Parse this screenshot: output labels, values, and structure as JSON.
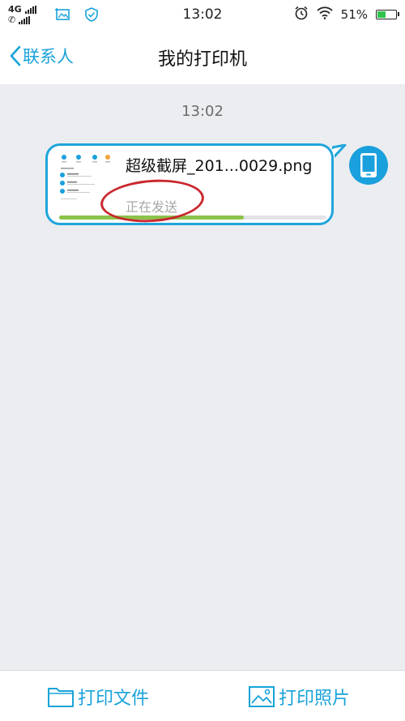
{
  "status_bar": {
    "network": "4G",
    "time": "13:02",
    "battery": "51%",
    "battery_level": 0.51,
    "icons": [
      "signal-icon",
      "call-signal-icon",
      "screenshot-icon",
      "shield-check-icon",
      "alarm-icon",
      "wifi-icon",
      "battery-icon"
    ]
  },
  "nav": {
    "back_label": "联系人",
    "title": "我的打印机"
  },
  "chat": {
    "timestamp": "13:02",
    "message": {
      "file_name": "超级截屏_201...0029.png",
      "status": "正在发送",
      "progress": 0.69
    }
  },
  "bottom": {
    "print_file_label": "打印文件",
    "print_photo_label": "打印照片"
  },
  "colors": {
    "accent": "#19a3d9",
    "progress": "#8bc34a",
    "annotation": "#c9282e",
    "background": "#ebedf0"
  }
}
